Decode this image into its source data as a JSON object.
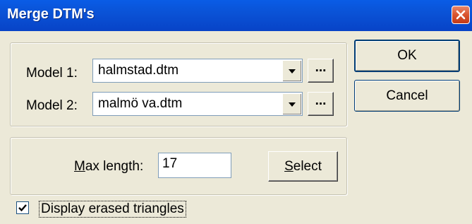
{
  "window": {
    "title": "Merge DTM's"
  },
  "models": [
    {
      "label": "Model 1:",
      "value": "halmstad.dtm",
      "browse_label": "..."
    },
    {
      "label": "Model 2:",
      "value": "malmö va.dtm",
      "browse_label": "..."
    }
  ],
  "max_length": {
    "label_mnemonic": "M",
    "label_rest": "ax length:",
    "value": "17"
  },
  "select_button": {
    "mnemonic": "S",
    "rest": "elect"
  },
  "ok_button": "OK",
  "cancel_button": "Cancel",
  "display_erased": {
    "label": "Display erased triangles",
    "checked": true
  },
  "icons": {
    "close": "close-icon",
    "dropdown": "chevron-down-icon",
    "check": "checkmark-icon"
  },
  "colors": {
    "titlebar": "#0a54d8",
    "close": "#d9542f",
    "face": "#ece9d8"
  }
}
